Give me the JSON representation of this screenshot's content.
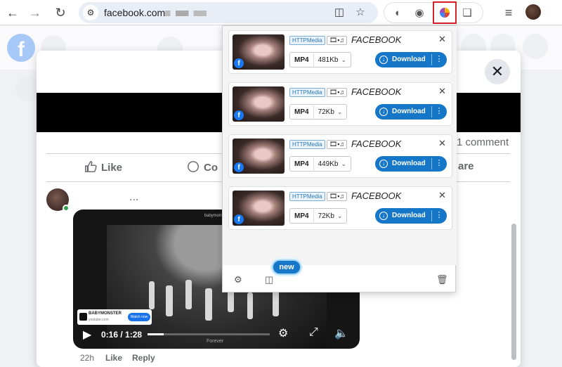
{
  "browser": {
    "url_domain": "facebook.com",
    "back_icon": "arrow-left-icon",
    "forward_icon": "arrow-right-icon",
    "reload_icon": "reload-icon"
  },
  "post": {
    "comment_count": "1 comment",
    "like_label": "Like",
    "comment_label_partial": "Co",
    "share_label_partial": "are",
    "more": "...",
    "time": "22h",
    "like_link": "Like",
    "reply_link": "Reply"
  },
  "video": {
    "channel_title": "babymonster",
    "card_title": "BABYMONSTER",
    "card_sub": "youtube.com",
    "watch_now": "Watch now",
    "time": "0:16 / 1:28",
    "progress": 0.13,
    "caption": "Forever"
  },
  "popup": {
    "items": [
      {
        "badge": "HTTPMedia",
        "flags": "🎞▪♫",
        "source": "FACEBOOK",
        "format": "MP4",
        "size": "481Kb",
        "download": "Download"
      },
      {
        "badge": "HTTPMedia",
        "flags": "🎞▪♫",
        "source": "FACEBOOK",
        "format": "MP4",
        "size": "72Kb",
        "download": "Download"
      },
      {
        "badge": "HTTPMedia",
        "flags": "🎞▪♫",
        "source": "FACEBOOK",
        "format": "MP4",
        "size": "449Kb",
        "download": "Download"
      },
      {
        "badge": "HTTPMedia",
        "flags": "🎞▪♫",
        "source": "FACEBOOK",
        "format": "MP4",
        "size": "72Kb",
        "download": "Download"
      }
    ],
    "new_label": "new"
  },
  "colors": {
    "download_blue": "#1677c8",
    "facebook_blue": "#1877f2",
    "highlight_red": "#d6202a"
  }
}
